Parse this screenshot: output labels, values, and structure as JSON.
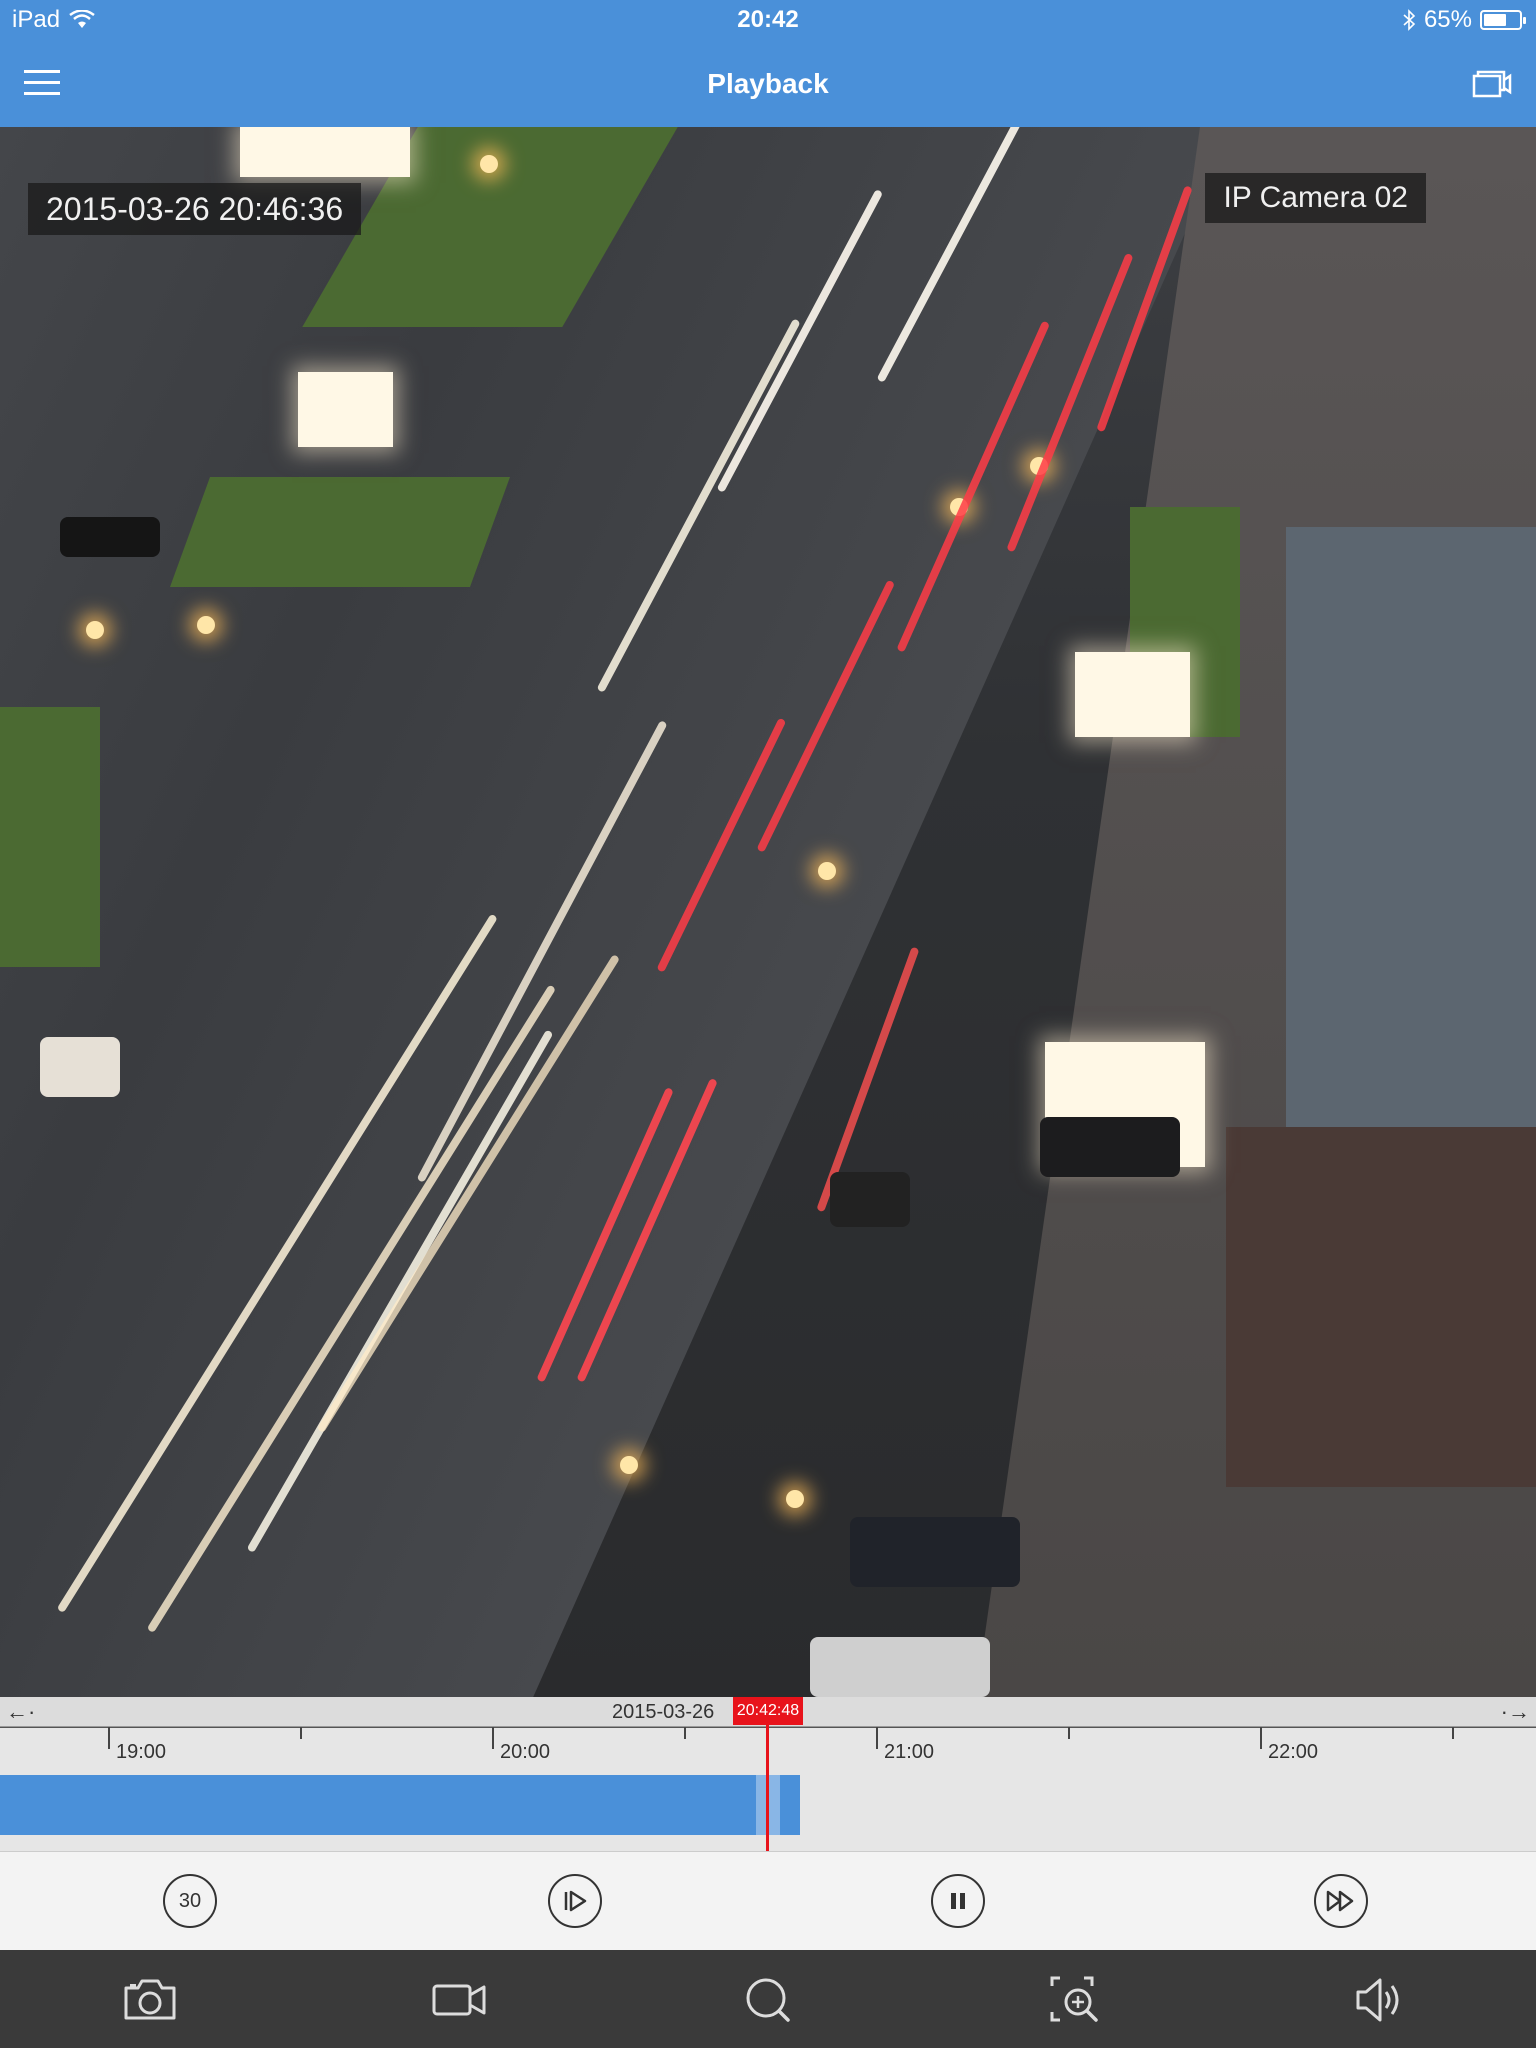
{
  "status_bar": {
    "device": "iPad",
    "time": "20:42",
    "battery_percent": "65%",
    "battery_level": 0.65
  },
  "nav": {
    "title": "Playback",
    "menu_icon": "hamburger-menu-icon",
    "right_icon": "camera-switch-icon"
  },
  "video": {
    "timestamp": "2015-03-26  20:46:36",
    "camera_name": "IP Camera 02"
  },
  "timeline": {
    "date": "2015-03-26",
    "cursor_time": "20:42:48",
    "hours": [
      "19:00",
      "20:00",
      "21:00",
      "22:00"
    ],
    "recorded_until": "20:48",
    "colors": {
      "recording": "#4a90d9",
      "cursor": "#e8131b"
    }
  },
  "controls": {
    "skip_back_label": "30",
    "icons": [
      "rewind-30-icon",
      "slow-play-icon",
      "pause-icon",
      "fast-forward-icon"
    ]
  },
  "toolbar": {
    "icons": [
      "snapshot-camera-icon",
      "record-video-icon",
      "search-icon",
      "zoom-in-icon",
      "speaker-icon"
    ]
  },
  "colors": {
    "accent": "#4a90d9",
    "toolbar_bg": "#3a3a3a"
  }
}
